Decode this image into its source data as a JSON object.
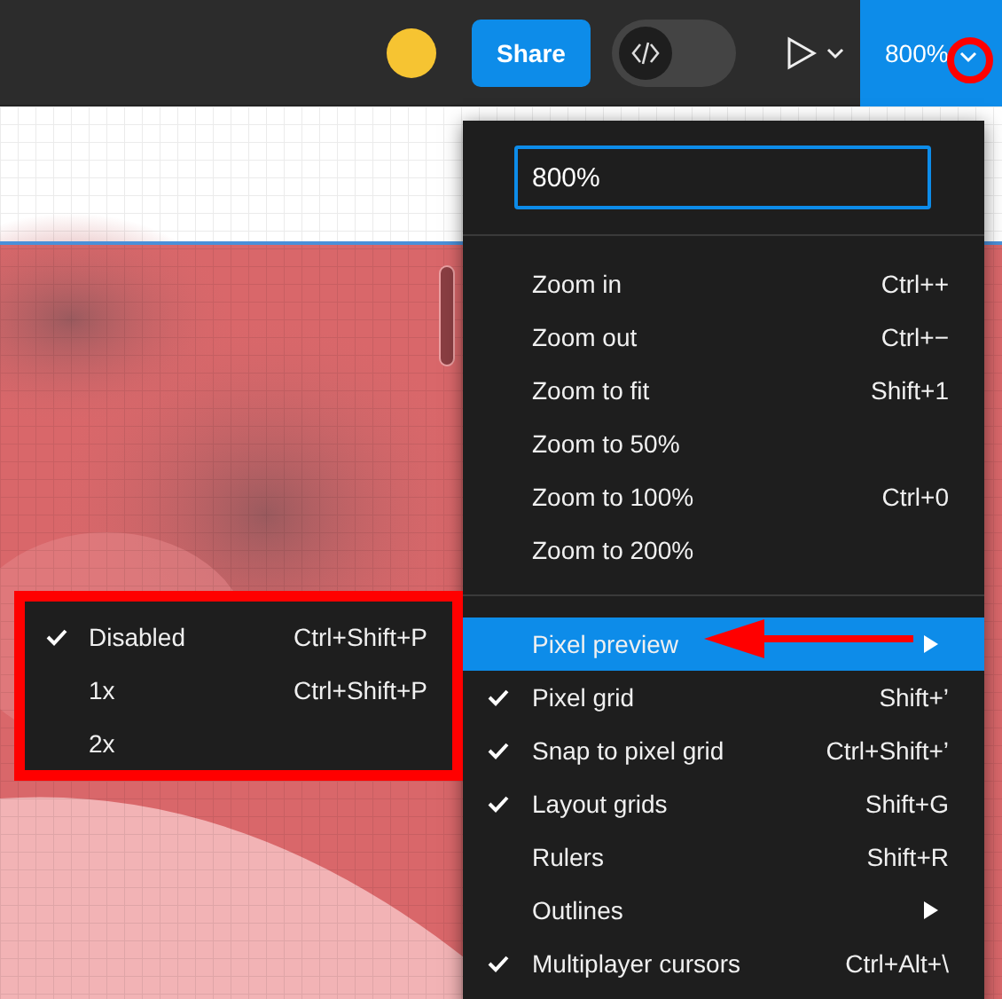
{
  "toolbar": {
    "share_button": "Share",
    "zoom_level": "800%",
    "code_toggle": {
      "on": false
    }
  },
  "zoom_menu": {
    "input_value": "800%",
    "zoom_items": [
      {
        "label": "Zoom in",
        "shortcut": "Ctrl++"
      },
      {
        "label": "Zoom out",
        "shortcut": "Ctrl+−"
      },
      {
        "label": "Zoom to fit",
        "shortcut": "Shift+1"
      },
      {
        "label": "Zoom to 50%"
      },
      {
        "label": "Zoom to 100%",
        "shortcut": "Ctrl+0"
      },
      {
        "label": "Zoom to 200%"
      }
    ],
    "view_items": [
      {
        "label": "Pixel preview",
        "checked": false,
        "selected": true,
        "submenu": true
      },
      {
        "label": "Pixel grid",
        "shortcut": "Shift+’",
        "checked": true,
        "selected": false,
        "submenu": false
      },
      {
        "label": "Snap to pixel grid",
        "shortcut": "Ctrl+Shift+’",
        "checked": true,
        "selected": false,
        "submenu": false
      },
      {
        "label": "Layout grids",
        "shortcut": "Shift+G",
        "checked": true,
        "selected": false,
        "submenu": false
      },
      {
        "label": "Rulers",
        "shortcut": "Shift+R",
        "checked": false,
        "selected": false,
        "submenu": false
      },
      {
        "label": "Outlines",
        "checked": false,
        "selected": false,
        "submenu": true
      },
      {
        "label": "Multiplayer cursors",
        "shortcut": "Ctrl+Alt+\\",
        "checked": true,
        "selected": false,
        "submenu": false
      }
    ]
  },
  "pixel_preview_submenu": [
    {
      "label": "Disabled",
      "shortcut": "Ctrl+Shift+P",
      "checked": true
    },
    {
      "label": "1x",
      "shortcut": "Ctrl+Shift+P",
      "checked": false
    },
    {
      "label": "2x",
      "checked": false
    }
  ]
}
